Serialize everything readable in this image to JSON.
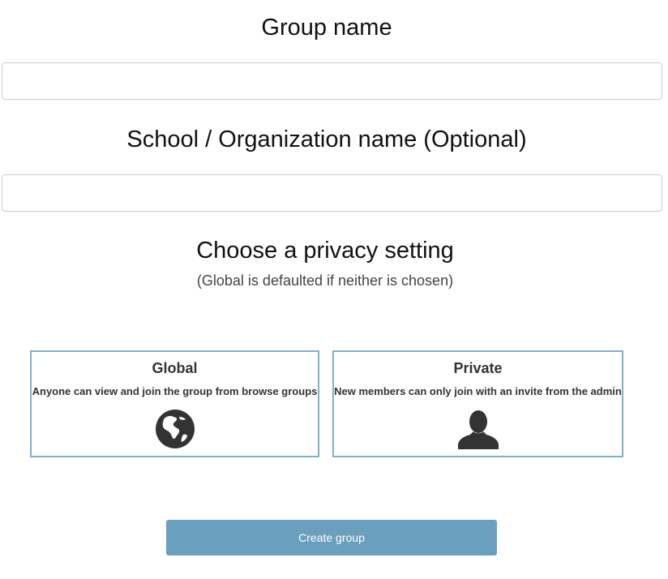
{
  "form": {
    "group_name_label": "Group name",
    "group_name_value": "",
    "org_name_label": "School / Organization name (Optional)",
    "org_name_value": "",
    "privacy_heading": "Choose a privacy setting",
    "privacy_note": "(Global is defaulted if neither is chosen)"
  },
  "privacy_options": [
    {
      "title": "Global",
      "description": "Anyone can view and join the group from browse groups",
      "icon": "globe-icon"
    },
    {
      "title": "Private",
      "description": "New members can only join with an invite from the admin",
      "icon": "user-icon"
    }
  ],
  "actions": {
    "create_label": "Create group"
  },
  "colors": {
    "card_border": "#7fb0c8",
    "button_bg": "#6a9fbd",
    "icon_fill": "#333333"
  }
}
